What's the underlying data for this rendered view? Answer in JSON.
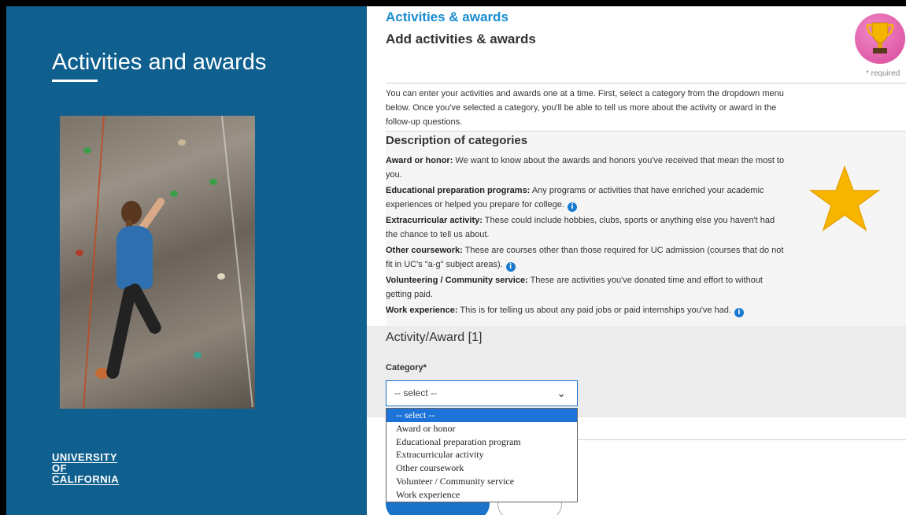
{
  "slide": {
    "title": "Activities and awards",
    "logo": [
      "UNIVERSITY",
      "OF",
      "CALIFORNIA"
    ]
  },
  "form": {
    "brand": "Activities & awards",
    "heading": "Add activities & awards",
    "required_note": "* required",
    "intro": "You can enter your activities and awards one at a time. First, select a category from the dropdown menu below. Once you've selected a category, you'll be able to tell us more about the activity or award in the follow-up questions.",
    "desc_heading": "Description of categories",
    "categories": [
      {
        "name": "Award or honor:",
        "text": " We want to know about the awards and honors you've received that mean the most to you.",
        "info": false
      },
      {
        "name": "Educational preparation programs:",
        "text": " Any programs or activities that have enriched your academic experiences or helped you prepare for college.",
        "info": true
      },
      {
        "name": "Extracurricular activity:",
        "text": " These could include hobbies, clubs, sports or anything else you haven't had the chance to tell us about.",
        "info": false
      },
      {
        "name": "Other coursework:",
        "text": " These are courses other than those required for UC admission (courses that do not fit in UC's \"a-g\" subject areas).",
        "info": true
      },
      {
        "name": "Volunteering / Community service:",
        "text": " These are activities you've donated time and effort to without getting paid.",
        "info": false
      },
      {
        "name": "Work experience:",
        "text": " This is for telling us about any paid jobs or paid internships you've had.",
        "info": true
      }
    ],
    "section_heading": "Activity/Award [1]",
    "category_label": "Category*",
    "select_value": "-- select --",
    "options": [
      "-- select --",
      "Award or honor",
      "Educational preparation program",
      "Extracurricular activity",
      "Other coursework",
      "Volunteer / Community service",
      "Work experience"
    ],
    "selected_option_index": 0
  },
  "colors": {
    "left_panel": "#0f5f8f",
    "brand": "#1a8ccf",
    "accent": "#1a73c9",
    "star": "#f7b500"
  },
  "icons": {
    "trophy": "trophy-icon",
    "star": "star-icon",
    "info": "info-icon",
    "chevron": "chevron-down-icon"
  }
}
